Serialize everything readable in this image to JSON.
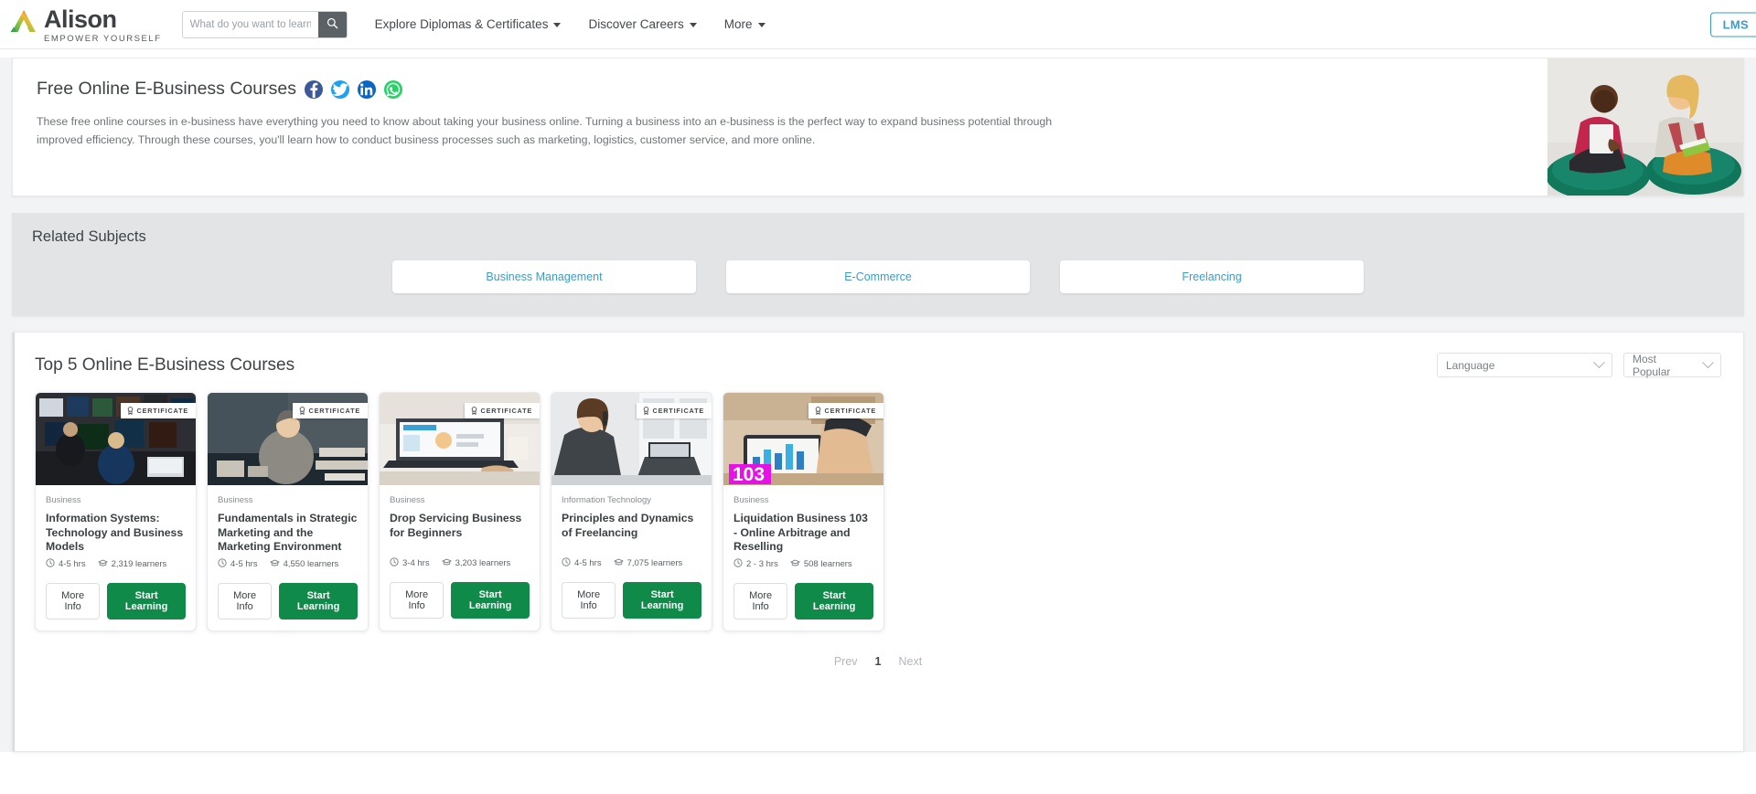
{
  "header": {
    "logo": {
      "word": "Alison",
      "tagline": "EMPOWER YOURSELF",
      "mark": "alison-logo-icon"
    },
    "search": {
      "placeholder": "What do you want to learn?",
      "value": "",
      "icon": "search-icon"
    },
    "nav": [
      {
        "label": "Explore Diplomas & Certificates",
        "icon": "chevron-down-icon"
      },
      {
        "label": "Discover Careers",
        "icon": "chevron-down-icon"
      },
      {
        "label": "More",
        "icon": "chevron-down-icon"
      }
    ],
    "lms_label": "LMS",
    "lms_color": "#3e9dc4"
  },
  "hero": {
    "title": "Free Online E-Business Courses",
    "share": [
      {
        "name": "facebook-icon",
        "color": "#3b5998",
        "glyph": "f"
      },
      {
        "name": "twitter-icon",
        "color": "#1da1f2",
        "glyph": "t"
      },
      {
        "name": "linkedin-icon",
        "color": "#0a66c2",
        "glyph": "in"
      },
      {
        "name": "whatsapp-icon",
        "color": "#25d366",
        "glyph": "w"
      }
    ],
    "description": "These free online courses in e-business have everything you need to know about taking your business online. Turning a business into an e-business is the perfect way to expand business potential through improved efficiency. Through these courses, you'll learn how to conduct business processes such as marketing, logistics, customer service, and more online.",
    "image_alt": "two-learners-on-beanbags-photo"
  },
  "related": {
    "title": "Related Subjects",
    "subjects": [
      {
        "label": "Business Management"
      },
      {
        "label": "E-Commerce"
      },
      {
        "label": "Freelancing"
      }
    ],
    "link_color": "#3d9cc6"
  },
  "courses_section": {
    "title": "Top 5 Online E-Business Courses",
    "filters": {
      "language": {
        "value": "Language",
        "icon": "chevron-down-icon"
      },
      "sort": {
        "value": "Most Popular",
        "icon": "chevron-down-icon"
      }
    },
    "badge_label": "CERTIFICATE",
    "badge_icon": "certificate-icon",
    "duration_icon": "clock-icon",
    "learners_icon": "graduation-cap-icon",
    "more_info_label": "More Info",
    "start_learning_label": "Start Learning",
    "accent_color": "#108a49",
    "cards": [
      {
        "category": "Business",
        "title": "Information Systems: Technology and Business Models",
        "duration": "4-5 hrs",
        "learners": "2,319 learners",
        "thumb": "trading-floor-monitors-photo"
      },
      {
        "category": "Business",
        "title": "Fundamentals in Strategic Marketing and the Marketing Environment",
        "duration": "4-5 hrs",
        "learners": "4,550 learners",
        "thumb": "woman-at-desk-with-charts-photo"
      },
      {
        "category": "Business",
        "title": "Drop Servicing Business for Beginners",
        "duration": "3-4 hrs",
        "learners": "3,203 learners",
        "thumb": "laptop-drop-servicing-photo"
      },
      {
        "category": "Information Technology",
        "title": "Principles and Dynamics of Freelancing",
        "duration": "4-5 hrs",
        "learners": "7,075 learners",
        "thumb": "woman-on-phone-with-laptop-photo"
      },
      {
        "category": "Business",
        "title": "Liquidation Business 103 - Online Arbitrage and Reselling",
        "duration": "2 - 3 hrs",
        "learners": "508 learners",
        "thumb": "hands-on-tablet-103-photo"
      }
    ],
    "pagination": {
      "prev": "Prev",
      "current": "1",
      "next": "Next"
    }
  }
}
